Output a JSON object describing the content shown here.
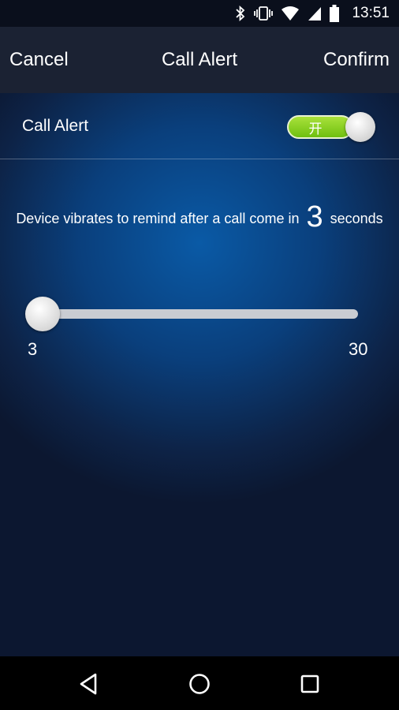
{
  "status_bar": {
    "time": "13:51",
    "icons": [
      "bluetooth-icon",
      "vibrate-icon",
      "wifi-icon",
      "signal-icon",
      "battery-icon"
    ]
  },
  "app_bar": {
    "cancel_label": "Cancel",
    "title": "Call Alert",
    "confirm_label": "Confirm"
  },
  "call_alert_row": {
    "label": "Call Alert",
    "toggle_text": "开",
    "toggle_on": true,
    "toggle_color": "#8fd42a"
  },
  "description": {
    "prefix": "Device vibrates to remind after a call come in",
    "value": "3",
    "suffix": "seconds"
  },
  "slider": {
    "min_label": "3",
    "max_label": "30",
    "min": 3,
    "max": 30,
    "value": 3
  },
  "nav_bar": {
    "icons": [
      "back-icon",
      "home-icon",
      "recents-icon"
    ]
  }
}
